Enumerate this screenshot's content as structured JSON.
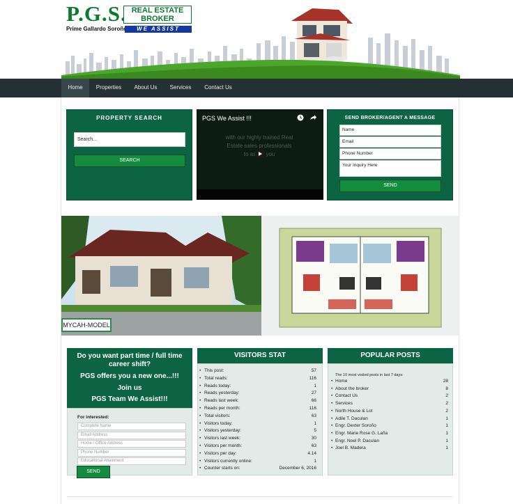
{
  "header": {
    "logo_pgs": "P.G.S.",
    "logo_real_estate": "REAL ESTATE",
    "logo_broker": "BROKER",
    "logo_we_assist": "WE ASSIST",
    "logo_name": "Prime Gallardo Soroño"
  },
  "nav": {
    "items": [
      {
        "label": "Home",
        "active": true
      },
      {
        "label": "Properties"
      },
      {
        "label": "About Us"
      },
      {
        "label": "Services"
      },
      {
        "label": "Contact Us"
      }
    ]
  },
  "property_search": {
    "title": "PROPERTY SEARCH",
    "input_value": "Search...",
    "button_label": "SEARCH"
  },
  "video": {
    "title": "PGS We Assist !!!",
    "overlay_text": "with our highly trained Real Estate sales professionals to assist you"
  },
  "message_form": {
    "title": "SEND BROKER/AGENT A MESSAGE",
    "name_placeholder": "Name",
    "email_placeholder": "Email",
    "phone_placeholder": "Phone Number",
    "inquiry_placeholder": "Your Inquiry Here",
    "send_label": "SEND"
  },
  "slider": {
    "label": "MYCAH-MODEL"
  },
  "recruit": {
    "line1": "Do you want part time / full time career shift?",
    "line2": "PGS offers you a new one...!!!",
    "line3": "Join us",
    "line4": "PGS Team We Assist!!!",
    "for_interested": "For interested:",
    "placeholders": [
      "Complete Name",
      "Email Address",
      "Home / Office Address",
      "Phone Number",
      "Educational Attainment"
    ],
    "send_label": "SEND"
  },
  "visitors": {
    "title": "VISITORS STAT",
    "rows": [
      {
        "label": "This post:",
        "value": "57"
      },
      {
        "label": "Total reads:",
        "value": "116"
      },
      {
        "label": "Reads today:",
        "value": "1"
      },
      {
        "label": "Reads yesterday:",
        "value": "27"
      },
      {
        "label": "Reads last week:",
        "value": "66"
      },
      {
        "label": "Reads per month:",
        "value": "116"
      },
      {
        "label": "Total visitors:",
        "value": "63"
      },
      {
        "label": "Visitors today:",
        "value": "1"
      },
      {
        "label": "Visitors yesterday:",
        "value": "5"
      },
      {
        "label": "Visitors last week:",
        "value": "30"
      },
      {
        "label": "Visitors per month:",
        "value": "63"
      },
      {
        "label": "Visitors per day:",
        "value": "4.14"
      },
      {
        "label": "Visitors currently online:",
        "value": "1"
      },
      {
        "label": "Counter starts on:",
        "value": "December 6, 2016"
      }
    ]
  },
  "popular": {
    "title": "POPULAR POSTS",
    "subtitle": "The 10 most visited posts in last 7 days:",
    "rows": [
      {
        "label": "Home",
        "value": "28"
      },
      {
        "label": "About the broker",
        "value": "8"
      },
      {
        "label": "Contact Us",
        "value": "2"
      },
      {
        "label": "Services",
        "value": "2"
      },
      {
        "label": "North House & Lot",
        "value": "2"
      },
      {
        "label": "Adile T. Daculan",
        "value": "1"
      },
      {
        "label": "Engr. Dexter Soroño",
        "value": "1"
      },
      {
        "label": "Engr. Marie Rose G. Laña",
        "value": "1"
      },
      {
        "label": "Engr. Noel P. Daculan",
        "value": "1"
      },
      {
        "label": "Joel B. Madera",
        "value": "1"
      }
    ]
  },
  "colors": {
    "brand_green": "#0d6445",
    "button_green": "#138c3f",
    "nav_dark": "#243034"
  }
}
